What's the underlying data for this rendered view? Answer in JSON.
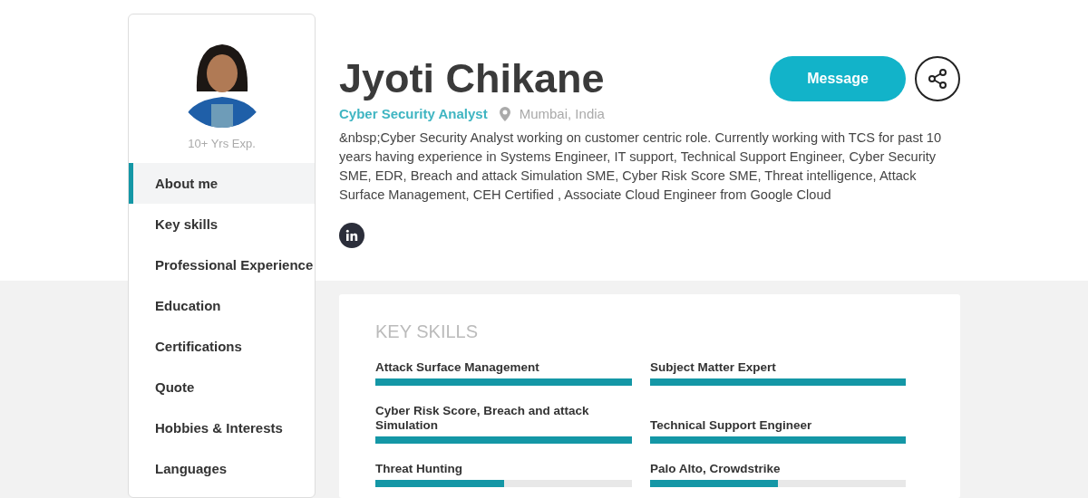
{
  "profile": {
    "experience": "10+ Yrs Exp.",
    "name": "Jyoti Chikane",
    "role": "Cyber Security Analyst",
    "location": "Mumbai, India",
    "bio": "&nbsp;Cyber Security Analyst working on customer centric role. Currently working with TCS for past 10 years having experience in Systems Engineer, IT support, Technical Support Engineer, Cyber Security SME, EDR, Breach and attack Simulation SME, Cyber Risk Score SME, Threat intelligence, Attack Surface Management, CEH Certified , Associate Cloud Engineer from Google Cloud"
  },
  "actions": {
    "message": "Message"
  },
  "sidebar": {
    "items": [
      {
        "label": "About me",
        "selected": true
      },
      {
        "label": "Key skills",
        "selected": false
      },
      {
        "label": "Professional Experience",
        "selected": false
      },
      {
        "label": "Education",
        "selected": false
      },
      {
        "label": "Certifications",
        "selected": false
      },
      {
        "label": "Quote",
        "selected": false
      },
      {
        "label": "Hobbies & Interests",
        "selected": false
      },
      {
        "label": "Languages",
        "selected": false
      }
    ]
  },
  "key_skills": {
    "title": "KEY SKILLS",
    "skills": [
      {
        "name": "Attack Surface Management",
        "level": 1
      },
      {
        "name": "Subject Matter Expert",
        "level": 1
      },
      {
        "name": "Cyber Risk Score, Breach and attack Simulation",
        "level": 1
      },
      {
        "name": "Technical Support Engineer",
        "level": 1
      },
      {
        "name": "Threat Hunting",
        "level": 0.5
      },
      {
        "name": "Palo Alto, Crowdstrike",
        "level": 0.5
      }
    ]
  }
}
